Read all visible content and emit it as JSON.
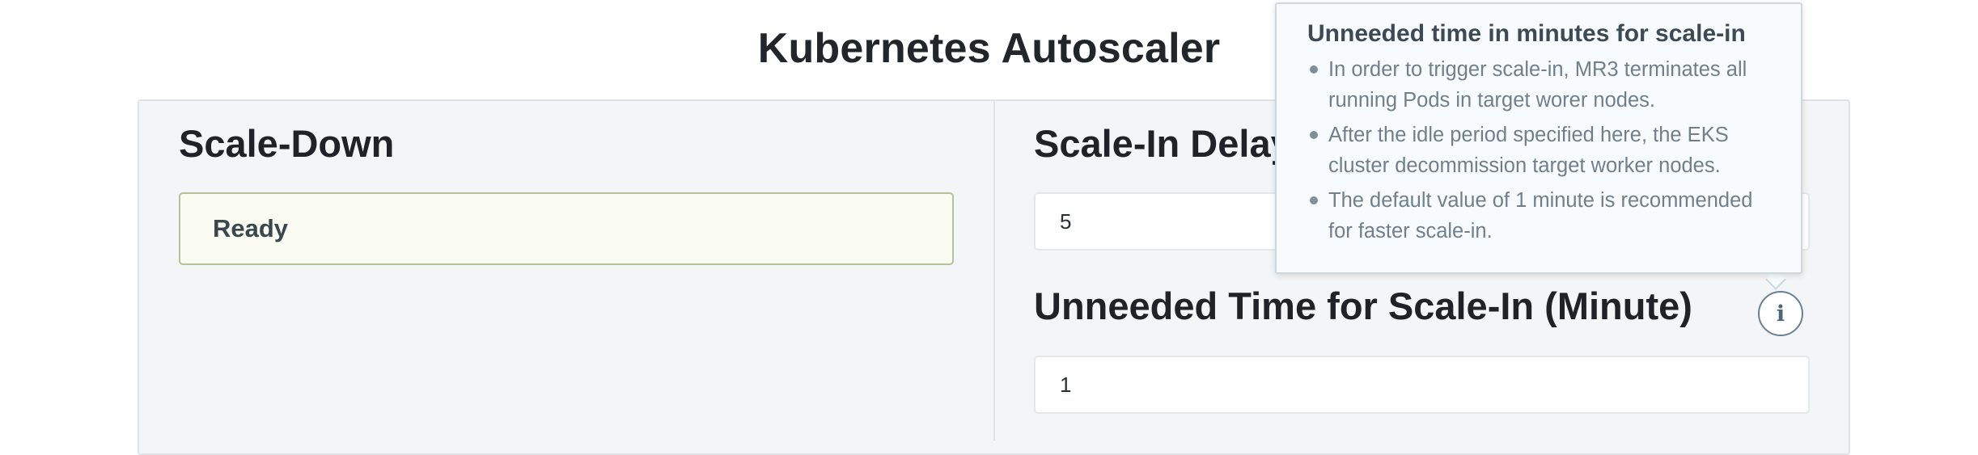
{
  "page": {
    "title": "Kubernetes Autoscaler"
  },
  "scale_down": {
    "heading": "Scale-Down",
    "status": "Ready"
  },
  "scale_in_delay": {
    "heading": "Scale-In Delay",
    "value": "5"
  },
  "unneeded_time": {
    "heading": "Unneeded Time for Scale-In (Minute)",
    "value": "1",
    "info_icon": "info-circle-icon"
  },
  "tooltip": {
    "title": "Unneeded time in minutes for scale-in",
    "items": [
      "In order to trigger scale-in, MR3 terminates all running Pods in target worer nodes.",
      "After the idle period specified here, the EKS cluster decommission target worker nodes.",
      "The default value of 1 minute is recommended for faster scale-in."
    ]
  },
  "colors": {
    "panel_background": "#f3f5f6",
    "status_background": "#fbfcf1",
    "status_border": "#b4c399",
    "tooltip_background": "#f7fbfd",
    "info_icon": "#4e6578"
  }
}
